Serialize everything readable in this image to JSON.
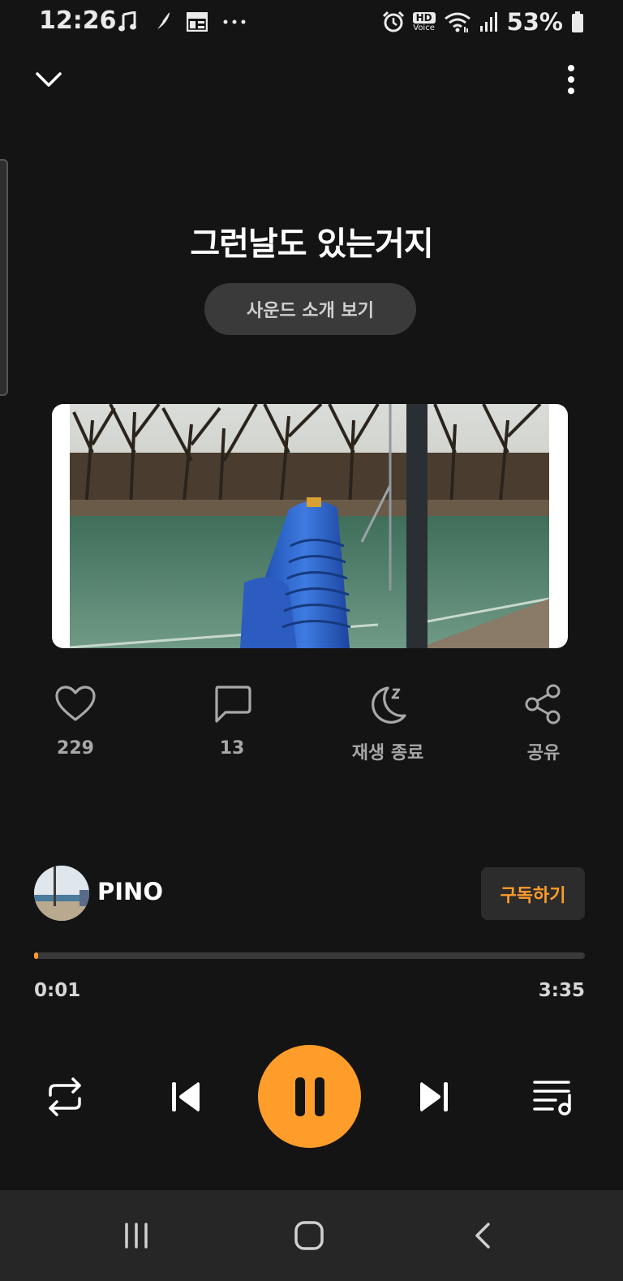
{
  "status_bar": {
    "time": "12:26",
    "battery_percent": "53%",
    "hd_label": "HD",
    "hd_sublabel": "Voice"
  },
  "track": {
    "title": "그런날도 있는거지",
    "intro_button": "사운드 소개 보기"
  },
  "actions": {
    "like_count": "229",
    "comment_count": "13",
    "sleep_timer_label": "재생 종료",
    "share_label": "공유"
  },
  "channel": {
    "name": "PINO",
    "subscribe_label": "구독하기"
  },
  "player": {
    "current_time": "0:01",
    "total_time": "3:35",
    "progress_fraction": 0.005
  },
  "colors": {
    "accent": "#ff9d2b",
    "background": "#141414",
    "nav_bar": "#262626"
  },
  "icons": {
    "status_left": [
      "music-note-icon",
      "feather-icon",
      "gallery-icon",
      "more-dots-icon"
    ],
    "status_right": [
      "alarm-icon",
      "hd-voice-icon",
      "wifi-icon",
      "signal-icon",
      "battery-icon"
    ],
    "controls": [
      "repeat-icon",
      "previous-icon",
      "pause-icon",
      "next-icon",
      "playlist-icon"
    ],
    "nav": [
      "recent-apps-icon",
      "home-icon",
      "back-icon"
    ]
  }
}
